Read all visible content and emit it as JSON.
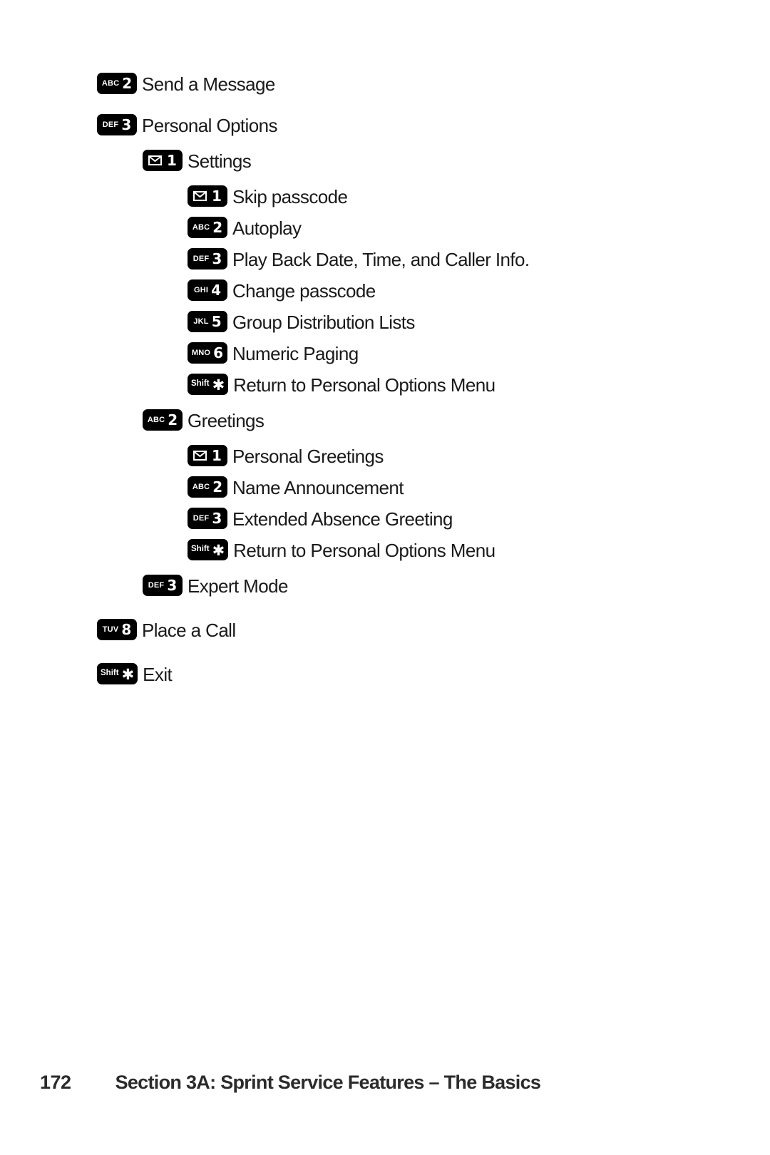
{
  "document": {
    "page_number": "172",
    "footer_title": "Section 3A: Sprint Service Features – The Basics"
  },
  "menu": {
    "items": [
      {
        "id": "send-a-message",
        "level": 1,
        "key": {
          "type": "digit",
          "letters": "ABC",
          "digit": "2"
        },
        "label": "Send a Message",
        "spacing": "none"
      },
      {
        "id": "personal-options",
        "level": 1,
        "key": {
          "type": "digit",
          "letters": "DEF",
          "digit": "3"
        },
        "label": "Personal Options",
        "spacing": "gap-lg"
      },
      {
        "id": "settings",
        "level": 2,
        "key": {
          "type": "envelope",
          "letters": "",
          "digit": "1"
        },
        "label": "Settings",
        "spacing": "gap-md"
      },
      {
        "id": "skip-passcode",
        "level": 3,
        "key": {
          "type": "envelope",
          "letters": "",
          "digit": "1"
        },
        "label": "Skip passcode",
        "spacing": "gap-md"
      },
      {
        "id": "autoplay",
        "level": 3,
        "key": {
          "type": "digit",
          "letters": "ABC",
          "digit": "2"
        },
        "label": "Autoplay",
        "spacing": "none"
      },
      {
        "id": "play-back-date-time-caller-info",
        "level": 3,
        "key": {
          "type": "digit",
          "letters": "DEF",
          "digit": "3"
        },
        "label": "Play Back Date, Time, and Caller Info.",
        "spacing": "none"
      },
      {
        "id": "change-passcode",
        "level": 3,
        "key": {
          "type": "digit",
          "letters": "GHI",
          "digit": "4"
        },
        "label": "Change passcode",
        "spacing": "none"
      },
      {
        "id": "group-distribution-lists",
        "level": 3,
        "key": {
          "type": "digit",
          "letters": "JKL",
          "digit": "5"
        },
        "label": "Group Distribution Lists",
        "spacing": "none"
      },
      {
        "id": "numeric-paging",
        "level": 3,
        "key": {
          "type": "digit",
          "letters": "MNO",
          "digit": "6"
        },
        "label": "Numeric Paging",
        "spacing": "none"
      },
      {
        "id": "return-to-personal-options-menu-settings",
        "level": 3,
        "key": {
          "type": "star",
          "letters": "Shift",
          "digit": ""
        },
        "label": "Return to Personal Options Menu",
        "spacing": "none"
      },
      {
        "id": "greetings",
        "level": 2,
        "key": {
          "type": "digit",
          "letters": "ABC",
          "digit": "2"
        },
        "label": "Greetings",
        "spacing": "gap-md"
      },
      {
        "id": "personal-greetings",
        "level": 3,
        "key": {
          "type": "envelope",
          "letters": "",
          "digit": "1"
        },
        "label": "Personal Greetings",
        "spacing": "gap-md"
      },
      {
        "id": "name-announcement",
        "level": 3,
        "key": {
          "type": "digit",
          "letters": "ABC",
          "digit": "2"
        },
        "label": "Name Announcement",
        "spacing": "none"
      },
      {
        "id": "extended-absence-greeting",
        "level": 3,
        "key": {
          "type": "digit",
          "letters": "DEF",
          "digit": "3"
        },
        "label": "Extended Absence Greeting",
        "spacing": "none"
      },
      {
        "id": "return-to-personal-options-menu-greetings",
        "level": 3,
        "key": {
          "type": "star",
          "letters": "Shift",
          "digit": ""
        },
        "label": "Return to Personal Options Menu",
        "spacing": "none"
      },
      {
        "id": "expert-mode",
        "level": 2,
        "key": {
          "type": "digit",
          "letters": "DEF",
          "digit": "3"
        },
        "label": "Expert Mode",
        "spacing": "gap-md"
      },
      {
        "id": "place-a-call",
        "level": 1,
        "key": {
          "type": "digit",
          "letters": "TUV",
          "digit": "8"
        },
        "label": "Place a Call",
        "spacing": "gap-xl"
      },
      {
        "id": "exit",
        "level": 1,
        "key": {
          "type": "star",
          "letters": "Shift",
          "digit": ""
        },
        "label": "Exit",
        "spacing": "gap-xl"
      }
    ]
  }
}
